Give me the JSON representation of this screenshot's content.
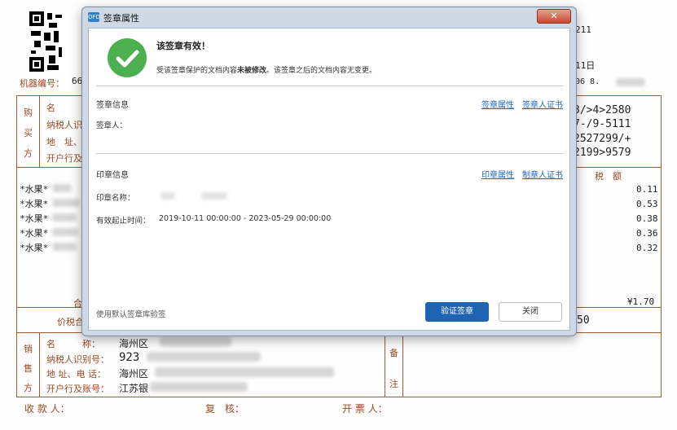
{
  "invoice": {
    "machine_label": "机器编号：",
    "machine_partial": "66",
    "header_right_1": "211",
    "header_right_2": "11日",
    "header_right_3": "06 8.",
    "buyer_side": [
      "购",
      "买",
      "方"
    ],
    "buyer_rows": [
      "名",
      "纳税人识",
      "地　址、",
      "开户行及"
    ],
    "cipher_lines": [
      "3/>4>2580",
      "7-/9-5111",
      "2527299/+",
      "2199>9579"
    ],
    "tax_header": "税　额",
    "items": [
      "*水果*",
      "*水果*",
      "*水果*",
      "*水果*",
      "*水果*"
    ],
    "tax_values": [
      "0.11",
      "0.53",
      "0.38",
      "0.36",
      "0.32"
    ],
    "total_tax": "¥1.70",
    "total_row_label": "合",
    "price_tax_label": "价税合",
    "price_tax_partial": "50",
    "seller_side": [
      "销",
      "售",
      "方"
    ],
    "seller_rows": [
      "名　　　称：",
      "纳税人识别号：",
      "地 址、电 话：",
      "开户行及账号："
    ],
    "seller_values": [
      "海州区",
      "923",
      "海州区",
      "江苏银"
    ],
    "remark_side": [
      "备",
      "注"
    ],
    "footer": [
      "收 款 人：",
      "复　核：",
      "开 票 人："
    ]
  },
  "dialog": {
    "title": "签章属性",
    "app_icon_text": "OFD",
    "close_symbol": "✕",
    "status_title": "该签章有效！",
    "status_desc_1": "受该签章保护的文档内容",
    "status_desc_bold": "未被修改",
    "status_desc_2": "。该签章之后的文档内容无变更。",
    "signature_section": {
      "title": "签章信息",
      "link_properties": "签章属性",
      "link_certificate": "签章人证书",
      "signer_label": "签章人："
    },
    "seal_section": {
      "title": "印章信息",
      "link_properties": "印章属性",
      "link_certificate": "制章人证书",
      "seal_name_label": "印章名称：",
      "validity_label": "有效起止时间：",
      "validity_value": "2019-10-11 00:00:00 - 2023-05-29 00:00:00"
    },
    "footer_link": "使用默认签章库验签",
    "verify_button": "验证签章",
    "close_button": "关闭"
  }
}
